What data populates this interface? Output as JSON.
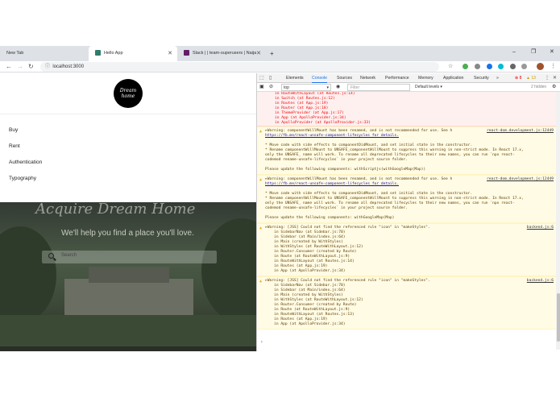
{
  "browser": {
    "tabs": [
      {
        "label": "New Tab",
        "favicon_color": "#dee1e6"
      },
      {
        "label": "Hello App",
        "favicon_color": "#2e7d6b"
      },
      {
        "label": "Slack | | team-superusers | Naija",
        "favicon_color": "#611f69"
      }
    ],
    "new_tab": "+",
    "window_controls": [
      "–",
      "❐",
      "✕"
    ],
    "url": "localhost:3000",
    "icons": [
      "back-icon",
      "forward-icon",
      "reload-icon",
      "info-icon",
      "star-icon",
      "profile-icon",
      "menu-icon"
    ]
  },
  "app": {
    "logo_line1": "Dream",
    "logo_line2": "home",
    "menu": [
      "Buy",
      "Rent",
      "Authentication",
      "Typography"
    ],
    "hero_title": "Acquire Dream Home",
    "hero_subtitle": "We'll help you find a place you'll love.",
    "search_placeholder": "Search"
  },
  "devtools": {
    "tabs": [
      "Elements",
      "Console",
      "Sources",
      "Network",
      "Performance",
      "Memory",
      "Application",
      "Security",
      "»"
    ],
    "active_tab": "Console",
    "error_count": "8",
    "warning_count": "13",
    "context": "top",
    "filter_placeholder": "Filter",
    "levels": "Default levels ▾",
    "hidden": "2 hidden",
    "top_stack": [
      "in RouteWithLayout (at Routes.js:14)",
      "in Switch (at Routes.js:12)",
      "in Routes (at App.js:19)",
      "in Router (at App.js:18)",
      "in ThemeProvider (at App.js:17)",
      "in App (at ApolloProvider.js:34)",
      "in ApolloProvider (at ApolloProvider.js:33)"
    ],
    "warn1": {
      "lines": [
        "▸Warning: componentWillMount has been renamed, and is not recommended for use. See h",
        "https://fb.me/react-unsafe-component-lifecycles for details.",
        "",
        "* Move code with side effects to componentDidMount, and set initial state in the constructor.",
        "* Rename componentWillMount to UNSAFE_componentWillMount to suppress this warning in non-strict mode. In React 17.x,",
        "only the UNSAFE_ name will work. To rename all deprecated lifecycles to their new names, you can run `npx react-",
        "codemod rename-unsafe-lifecycles` in your project source folder.",
        "",
        "Please update the following components: withScriptjs(withGoogleMap(Map))"
      ],
      "source": "react-dom.development.js:12449"
    },
    "warn2": {
      "lines": [
        "▸Warning: componentWillMount has been renamed, and is not recommended for use. See h",
        "https://fb.me/react-unsafe-component-lifecycles for details.",
        "",
        "* Move code with side effects to componentDidMount, and set initial state in the constructor.",
        "* Rename componentWillMount to UNSAFE_componentWillMount to suppress this warning in non-strict mode. In React 17.x,",
        "only the UNSAFE_ name will work. To rename all deprecated lifecycles to their new names, you can run `npx react-",
        "codemod rename-unsafe-lifecycles` in your project source folder.",
        "",
        "Please update the following components: withGoogleMap(Map)"
      ],
      "source": "react-dom.development.js:12449"
    },
    "warn3": {
      "lines": [
        "▸Warning: [JSS] Could not find the referenced rule \"icon\" in \"makeStyles\".",
        "    in SidebarNav (at Sidebar.js:70)",
        "    in Sidebar (at Main/index.js:64)",
        "    in Main (created by WithStyles)",
        "    in WithStyles (at RouteWithLayout.js:12)",
        "    in Router.Consumer (created by Route)",
        "    in Route (at RouteWithLayout.js:9)",
        "    in RouteWithLayout (at Routes.js:14)",
        "    in Routes (at App.js:19)",
        "    in App (at ApolloProvider.js:34)"
      ],
      "source": "backend.js:6"
    },
    "warn4": {
      "lines": [
        "▸Warning: [JSS] Could not find the referenced rule \"icon\" in \"makeStyles\".",
        "    in SidebarNav (at Sidebar.js:70)",
        "    in Sidebar (at Main/index.js:64)",
        "    in Main (created by WithStyles)",
        "    in WithStyles (at RouteWithLayout.js:12)",
        "    in Router.Consumer (created by Route)",
        "    in Route (at RouteWithLayout.js:9)",
        "    in RouteWithLayout (at Routes.js:13)",
        "    in Routes (at App.js:19)",
        "    in App (at ApolloProvider.js:34)"
      ],
      "source": "backend.js:6"
    },
    "prompt": "›"
  }
}
